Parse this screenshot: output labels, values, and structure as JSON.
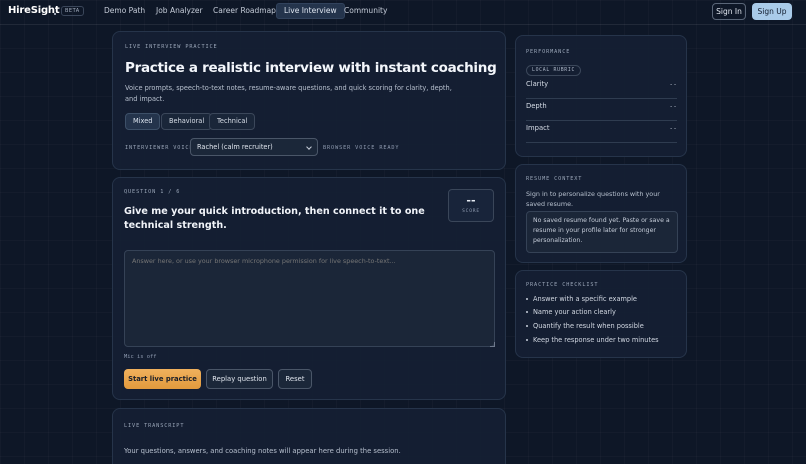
{
  "nav": {
    "logo": "HireSight",
    "badge": "BETA",
    "links": [
      "Demo Path",
      "Job Analyzer",
      "Career Roadmap",
      "Live Interview",
      "Community"
    ],
    "active_link": "Live Interview",
    "sign_in": "Sign In",
    "sign_up": "Sign Up"
  },
  "hero": {
    "eyebrow": "LIVE INTERVIEW PRACTICE",
    "title": "Practice a realistic interview with instant coaching",
    "description": "Voice prompts, speech-to-text notes, resume-aware questions, and quick scoring for clarity, depth, and impact.",
    "modes": [
      "Mixed",
      "Behavioral",
      "Technical"
    ],
    "active_mode": "Mixed",
    "voice_label": "INTERVIEWER VOICE",
    "voice_selected": "Rachel (calm recruiter)",
    "voice_status": "BROWSER VOICE READY"
  },
  "question": {
    "counter": "QUESTION 1 / 6",
    "text": "Give me your quick introduction, then connect it to one technical strength.",
    "score_value": "--",
    "score_label": "SCORE",
    "answer_placeholder": "Answer here, or use your browser microphone permission for live speech-to-text...",
    "mic_status": "Mic is off",
    "start_button": "Start live practice",
    "replay_button": "Replay question",
    "reset_button": "Reset"
  },
  "transcript": {
    "eyebrow": "LIVE TRANSCRIPT",
    "empty_text": "Your questions, answers, and coaching notes will appear here during the session."
  },
  "performance": {
    "eyebrow": "PERFORMANCE",
    "rubric_chip": "LOCAL RUBRIC",
    "metrics": [
      {
        "label": "Clarity",
        "value": "--"
      },
      {
        "label": "Depth",
        "value": "--"
      },
      {
        "label": "Impact",
        "value": "--"
      }
    ]
  },
  "resume_context": {
    "eyebrow": "RESUME CONTEXT",
    "description": "Sign in to personalize questions with your saved resume.",
    "notice": "No saved resume found yet. Paste or save a resume in your profile later for stronger personalization."
  },
  "checklist": {
    "eyebrow": "PRACTICE CHECKLIST",
    "items": [
      "Answer with a specific example",
      "Name your action clearly",
      "Quantify the result when possible",
      "Keep the response under two minutes"
    ]
  }
}
